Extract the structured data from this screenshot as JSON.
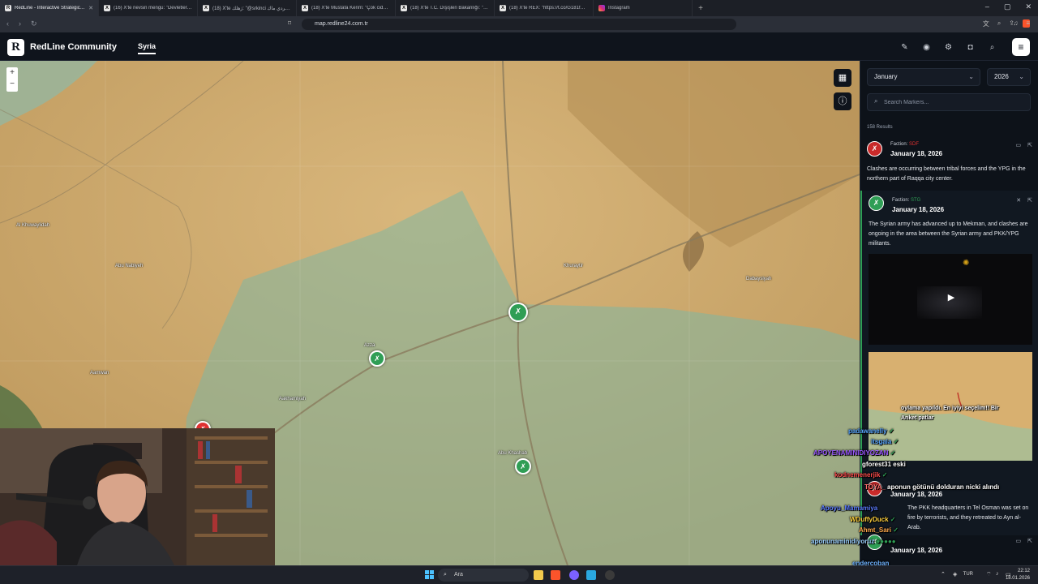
{
  "browser": {
    "tabs": [
      {
        "title": "RedLine - Interactive Strategic M",
        "active": true,
        "icon": "redline-icon"
      },
      {
        "title": "(16) X'te nevsin mengu: \"Devletler dı",
        "active": false,
        "icon": "x-icon"
      },
      {
        "title": "(18) X'te ژهلك: \"@srkinci الكردي ماك\"",
        "active": false,
        "icon": "x-icon"
      },
      {
        "title": "(18) X'te Mustafa Kerim: \"Çok ciddi b",
        "active": false,
        "icon": "x-icon"
      },
      {
        "title": "(18) X'te T.C. Dışişleri Bakanlığı: \"Son",
        "active": false,
        "icon": "x-icon"
      },
      {
        "title": "(18) X'te REX: \"https://t.co/G181fOVI",
        "active": false,
        "icon": "x-icon"
      },
      {
        "title": "Instagram",
        "active": false,
        "icon": "instagram-icon"
      }
    ],
    "url": "map.redline24.com.tr"
  },
  "app": {
    "logo_letter": "R",
    "brand": "RedLine Community",
    "nav_active": "Syria"
  },
  "map": {
    "zoom_in": "+",
    "zoom_out": "−",
    "places": [
      {
        "name": "Al Khuwaylidah"
      },
      {
        "name": "Abu Nabiyeh"
      },
      {
        "name": "Khuraytir"
      },
      {
        "name": "Dabaysiyah"
      },
      {
        "name": "Azza"
      },
      {
        "name": "Aamwan"
      },
      {
        "name": "Aakhamiyah"
      },
      {
        "name": "Abu Khashab"
      }
    ]
  },
  "panel": {
    "month": "January",
    "year": "2026",
    "search_placeholder": "Search Markers...",
    "results_count": "158 Results",
    "faction_label": "Faction:",
    "cards": [
      {
        "faction": "SDF",
        "faction_color": "#e03131",
        "date": "January 18, 2026",
        "text": "Clashes are occurring between tribal forces and the YPG in the northern part of Raqqa city center."
      },
      {
        "faction": "STG",
        "faction_color": "#2f9e55",
        "date": "January 18, 2026",
        "text": "The Syrian army has advanced up to Mekman, and clashes are ongoing in the area between the Syrian army and PKK/YPG militants."
      },
      {
        "faction": "SDF",
        "faction_color": "#e03131",
        "date": "January 18, 2026",
        "text": "The PKK headquarters in Tel Osman was set on fire by terrorists, and they retreated to Ayn al-Arab."
      },
      {
        "faction": "",
        "faction_color": "#2f9e55",
        "date": "January 18, 2026",
        "text": ""
      }
    ],
    "thumb_caption_1": "oylama yapıldı. En iyiyi seçelim!! Bir",
    "thumb_caption_2": "Anket patlar"
  },
  "chat": [
    {
      "user": "padawanelly",
      "msg": "",
      "color": "#58a6ff"
    },
    {
      "user": "itsgaia",
      "msg": "",
      "color": "#58a6ff"
    },
    {
      "user": "APOYENAMINIDIYOZAN",
      "msg": "",
      "color": "#9b59ff"
    },
    {
      "user": "gforest31",
      "msg": "eski",
      "color": "#ffffff"
    },
    {
      "user": "kodnemenerjik",
      "msg": "",
      "color": "#ff4d4d"
    },
    {
      "user": "TOYA_",
      "msg": "aponun götünü dolduran nicki alındı",
      "color": "#ff7070"
    },
    {
      "user": "Apoyu_Mamamiya",
      "msg": "",
      "color": "#5b7cff"
    },
    {
      "user": "WDuffyDuck",
      "msg": "",
      "color": "#ffd23f"
    },
    {
      "user": "Ahmt_Sari",
      "msg": "",
      "color": "#ffa94d"
    },
    {
      "user": "aponunaminidiyoruz",
      "msg": "",
      "color": "#9bd0ff"
    },
    {
      "user": "endercoban",
      "msg": "",
      "color": "#6fb3ff"
    }
  ],
  "taskbar": {
    "search": "Ara",
    "lang": "TUR",
    "time": "22:12",
    "date": "18.01.2026"
  },
  "colors": {
    "accent_green": "#2f9e55",
    "accent_red": "#e03131",
    "bg": "#0f141c"
  }
}
